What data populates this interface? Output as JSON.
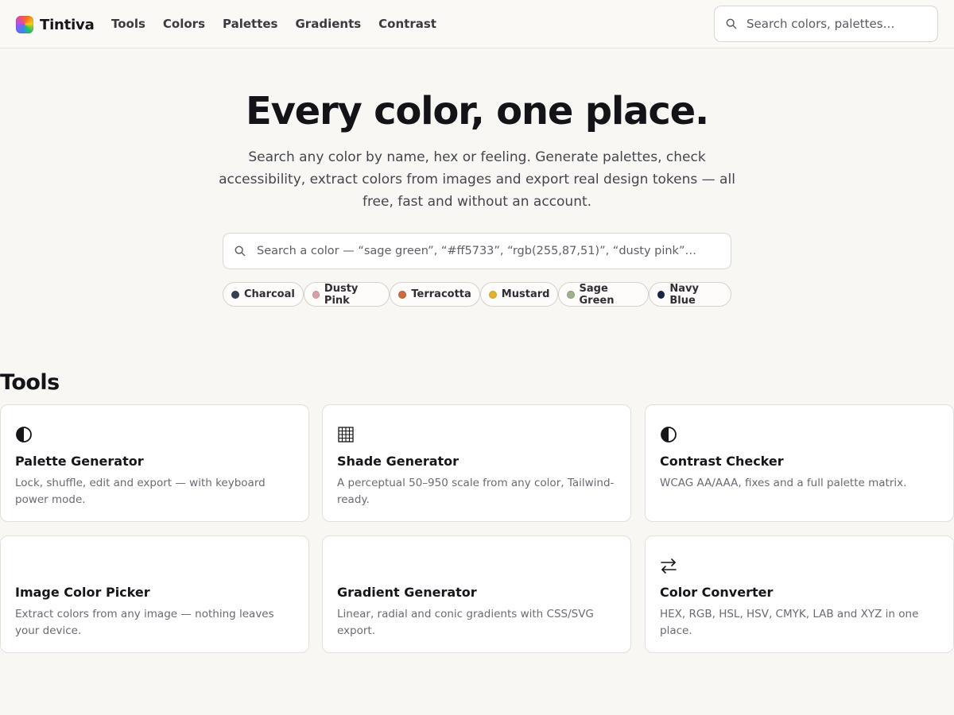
{
  "brand": {
    "name": "Tintiva"
  },
  "nav": [
    {
      "label": "Tools"
    },
    {
      "label": "Colors"
    },
    {
      "label": "Palettes"
    },
    {
      "label": "Gradients"
    },
    {
      "label": "Contrast"
    }
  ],
  "header_search": {
    "placeholder": "Search colors, palettes…"
  },
  "hero": {
    "title": "Every color, one place.",
    "subtitle": "Search any color by name, hex or feeling. Generate palettes, check accessibility, extract colors from images and export real design tokens — all free, fast and without an account.",
    "search_placeholder": "Search a color — “sage green”, “#ff5733”, “rgb(255,87,51)”, “dusty pink”…"
  },
  "chips": [
    {
      "label": "Charcoal",
      "color": "#374151"
    },
    {
      "label": "Dusty Pink",
      "color": "#d9a0aa"
    },
    {
      "label": "Terracotta",
      "color": "#cc6b3f"
    },
    {
      "label": "Mustard",
      "color": "#e0b430"
    },
    {
      "label": "Sage Green",
      "color": "#9cb08c"
    },
    {
      "label": "Navy Blue",
      "color": "#1b2447"
    }
  ],
  "tools": {
    "heading": "Tools",
    "cards": [
      {
        "title": "Palette Generator",
        "description": "Lock, shuffle, edit and export — with keyboard power mode.",
        "icon": "half-circle-icon"
      },
      {
        "title": "Shade Generator",
        "description": "A perceptual 50–950 scale from any color, Tailwind-ready.",
        "icon": "grid-icon"
      },
      {
        "title": "Contrast Checker",
        "description": "WCAG AA/AAA, fixes and a full palette matrix.",
        "icon": "half-circle-icon"
      },
      {
        "title": "Image Color Picker",
        "description": "Extract colors from any image — nothing leaves your device.",
        "icon": ""
      },
      {
        "title": "Gradient Generator",
        "description": "Linear, radial and conic gradients with CSS/SVG export.",
        "icon": ""
      },
      {
        "title": "Color Converter",
        "description": "HEX, RGB, HSL, HSV, CMYK, LAB and XYZ in one place.",
        "icon": "swap-arrows-icon"
      }
    ]
  }
}
